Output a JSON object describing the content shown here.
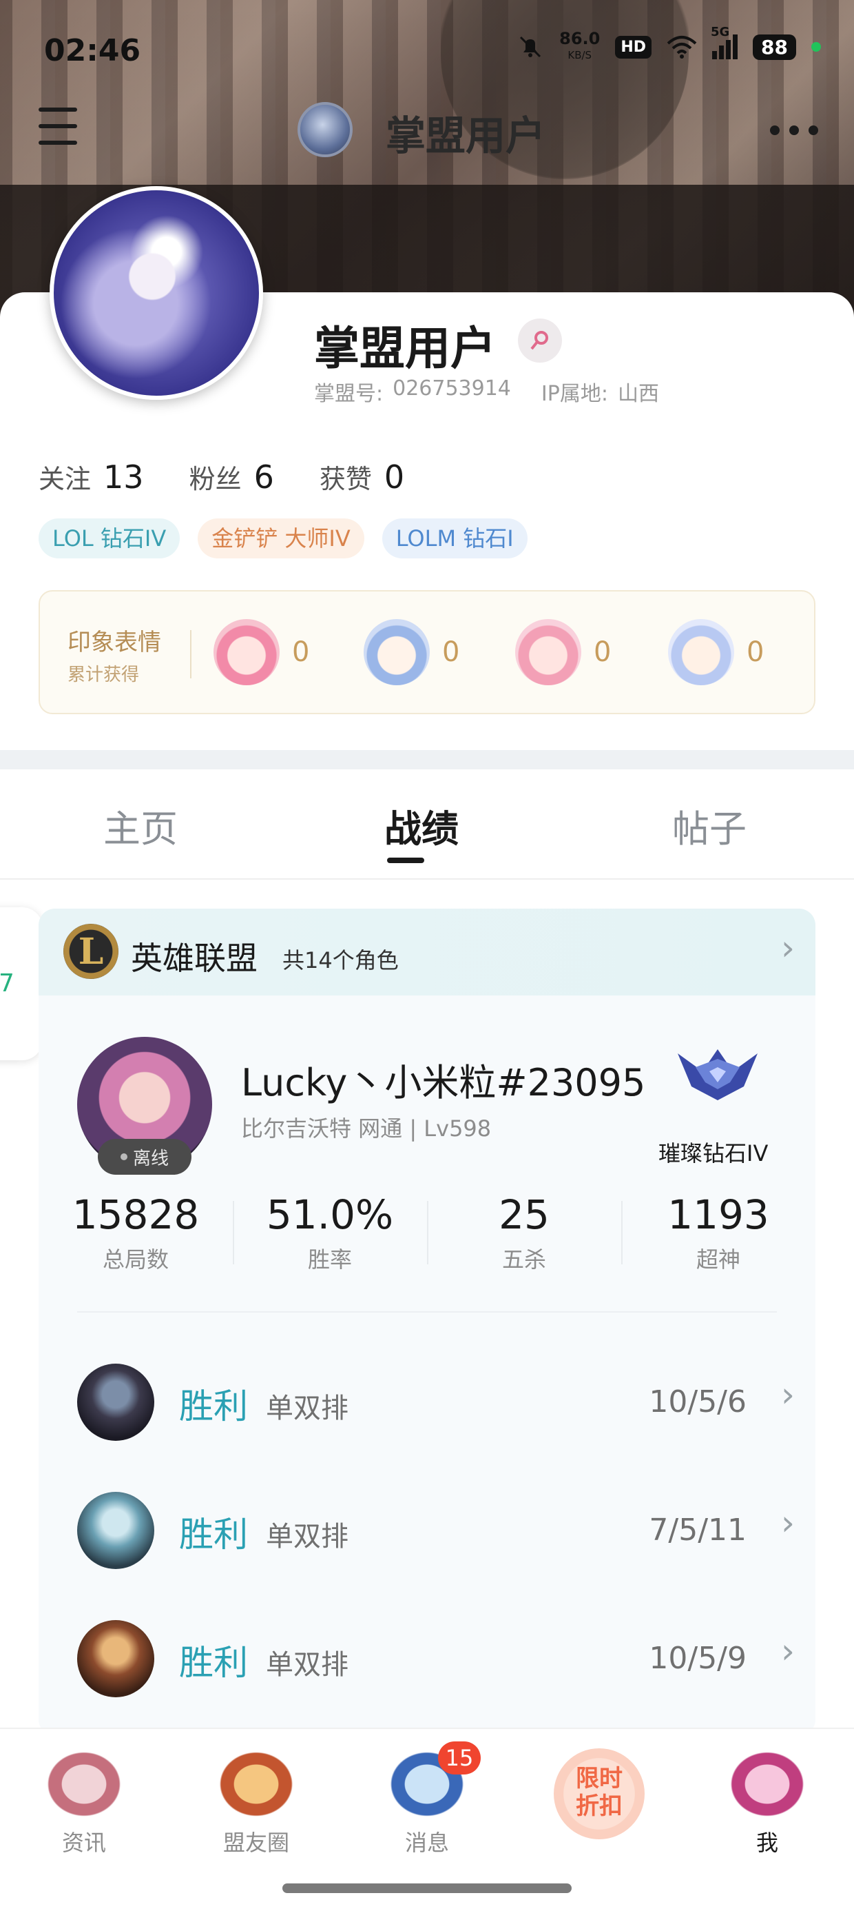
{
  "status_bar": {
    "time": "02:46",
    "net_speed": "86.0",
    "net_unit": "KB/S",
    "hd": "HD",
    "signal": "5G",
    "battery": "88"
  },
  "nav": {
    "title": "掌盟用户"
  },
  "profile": {
    "name": "掌盟用户",
    "id_label": "掌盟号:",
    "id_value": "026753914",
    "ip_label": "IP属地:",
    "ip_value": "山西",
    "stats": [
      {
        "label": "关注",
        "value": "13"
      },
      {
        "label": "粉丝",
        "value": "6"
      },
      {
        "label": "获赞",
        "value": "0"
      }
    ],
    "tags": [
      "LOL 钻石IV",
      "金铲铲 大师IV",
      "LOLM 钻石I"
    ]
  },
  "emotes": {
    "title": "印象表情",
    "subtitle": "累计获得",
    "counts": [
      "0",
      "0",
      "0",
      "0"
    ]
  },
  "tabs": [
    "主页",
    "战绩",
    "帖子"
  ],
  "active_tab": "战绩",
  "side_float_text": "7",
  "game": {
    "logo_letter": "L",
    "name": "英雄联盟",
    "role_count": "共14个角色",
    "summoner": "Lucky丶小米粒#23095",
    "server": "比尔吉沃特  网通 | Lv598",
    "status": "离线",
    "rank": "璀璨钻石IV",
    "kpis": [
      {
        "value": "15828",
        "label": "总局数"
      },
      {
        "value": "51.0%",
        "label": "胜率"
      },
      {
        "value": "25",
        "label": "五杀"
      },
      {
        "value": "1193",
        "label": "超神"
      }
    ],
    "matches": [
      {
        "result": "胜利",
        "mode": "单双排",
        "kda": "10/5/6"
      },
      {
        "result": "胜利",
        "mode": "单双排",
        "kda": "7/5/11"
      },
      {
        "result": "胜利",
        "mode": "单双排",
        "kda": "10/5/9"
      }
    ]
  },
  "bottom_nav": {
    "items": [
      "资讯",
      "盟友圈",
      "消息",
      "",
      "我"
    ],
    "message_badge": "15",
    "promo_line1": "限时",
    "promo_line2": "折扣"
  },
  "colors": {
    "win": "#2aa0b3",
    "badge": "#f0452f",
    "promo": "#f06845"
  }
}
